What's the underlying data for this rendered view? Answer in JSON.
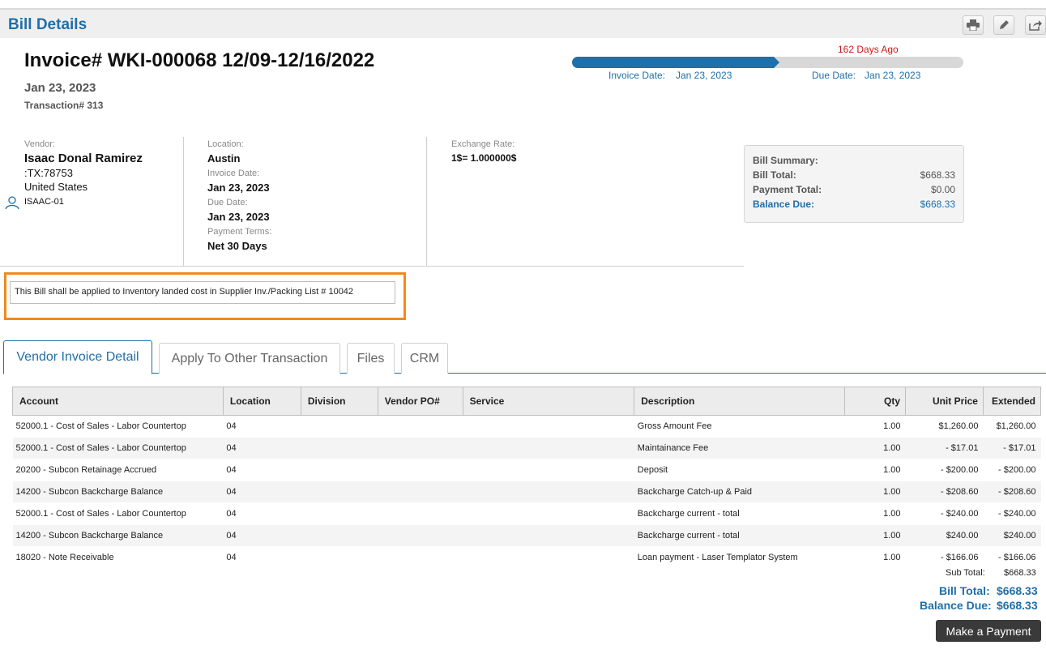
{
  "header": {
    "title": "Bill Details"
  },
  "toolbar": {
    "icons": [
      "print-icon",
      "edit-icon",
      "share-icon"
    ]
  },
  "invoice": {
    "title": "Invoice# WKI-000068 12/09-12/16/2022",
    "date": "Jan 23, 2023",
    "transaction": "Transaction# 313"
  },
  "timeline": {
    "days_ago": "162 Days Ago",
    "progress": 0.515,
    "invoice_date_label": "Invoice Date:",
    "invoice_date": "Jan 23, 2023",
    "due_date_label": "Due Date:",
    "due_date": "Jan 23, 2023"
  },
  "vendor": {
    "label": "Vendor:",
    "name": "Isaac Donal Ramirez",
    "address": ":TX:78753",
    "country": "United States",
    "code": "ISAAC-01"
  },
  "details": {
    "location_label": "Location:",
    "location": "Austin",
    "invoice_date_label": "Invoice Date:",
    "invoice_date": "Jan 23, 2023",
    "due_date_label": "Due Date:",
    "due_date": "Jan 23, 2023",
    "payment_terms_label": "Payment Terms:",
    "payment_terms": "Net 30 Days"
  },
  "exchange": {
    "label": "Exchange Rate:",
    "value": "1$= 1.000000$"
  },
  "summary": {
    "title": "Bill Summary:",
    "bill_total_label": "Bill Total:",
    "bill_total": "$668.33",
    "payment_total_label": "Payment Total:",
    "payment_total": "$0.00",
    "balance_due_label": "Balance Due:",
    "balance_due": "$668.33"
  },
  "note": "This Bill shall be applied to Inventory landed cost in Supplier Inv./Packing List # 10042",
  "tabs": [
    "Vendor Invoice Detail",
    "Apply To Other Transaction",
    "Files",
    "CRM"
  ],
  "table": {
    "headers": [
      "Account",
      "Location",
      "Division",
      "Vendor PO#",
      "Service",
      "Description",
      "Qty",
      "Unit Price",
      "Extended"
    ],
    "rows": [
      [
        "52000.1 - Cost of Sales - Labor Countertop",
        "04",
        "",
        "",
        "",
        "Gross Amount Fee",
        "1.00",
        "$1,260.00",
        "$1,260.00"
      ],
      [
        "52000.1 - Cost of Sales - Labor Countertop",
        "04",
        "",
        "",
        "",
        "Maintainance Fee",
        "1.00",
        "- $17.01",
        "- $17.01"
      ],
      [
        "20200 - Subcon Retainage Accrued",
        "04",
        "",
        "",
        "",
        "Deposit",
        "1.00",
        "- $200.00",
        "- $200.00"
      ],
      [
        "14200 - Subcon Backcharge Balance",
        "04",
        "",
        "",
        "",
        "Backcharge Catch-up & Paid",
        "1.00",
        "- $208.60",
        "- $208.60"
      ],
      [
        "52000.1 - Cost of Sales - Labor Countertop",
        "04",
        "",
        "",
        "",
        "Backcharge current - total",
        "1.00",
        "- $240.00",
        "- $240.00"
      ],
      [
        "14200 - Subcon Backcharge Balance",
        "04",
        "",
        "",
        "",
        "Backcharge current - total",
        "1.00",
        "$240.00",
        "$240.00"
      ],
      [
        "18020 - Note Receivable",
        "04",
        "",
        "",
        "",
        "Loan payment - Laser Templator System",
        "1.00",
        "- $166.06",
        "- $166.06"
      ]
    ]
  },
  "totals": {
    "sub_total_label": "Sub Total:",
    "sub_total": "$668.33",
    "bill_total_label": "Bill Total:",
    "bill_total": "$668.33",
    "balance_due_label": "Balance Due:",
    "balance_due": "$668.33"
  },
  "actions": {
    "make_payment": "Make a Payment"
  }
}
